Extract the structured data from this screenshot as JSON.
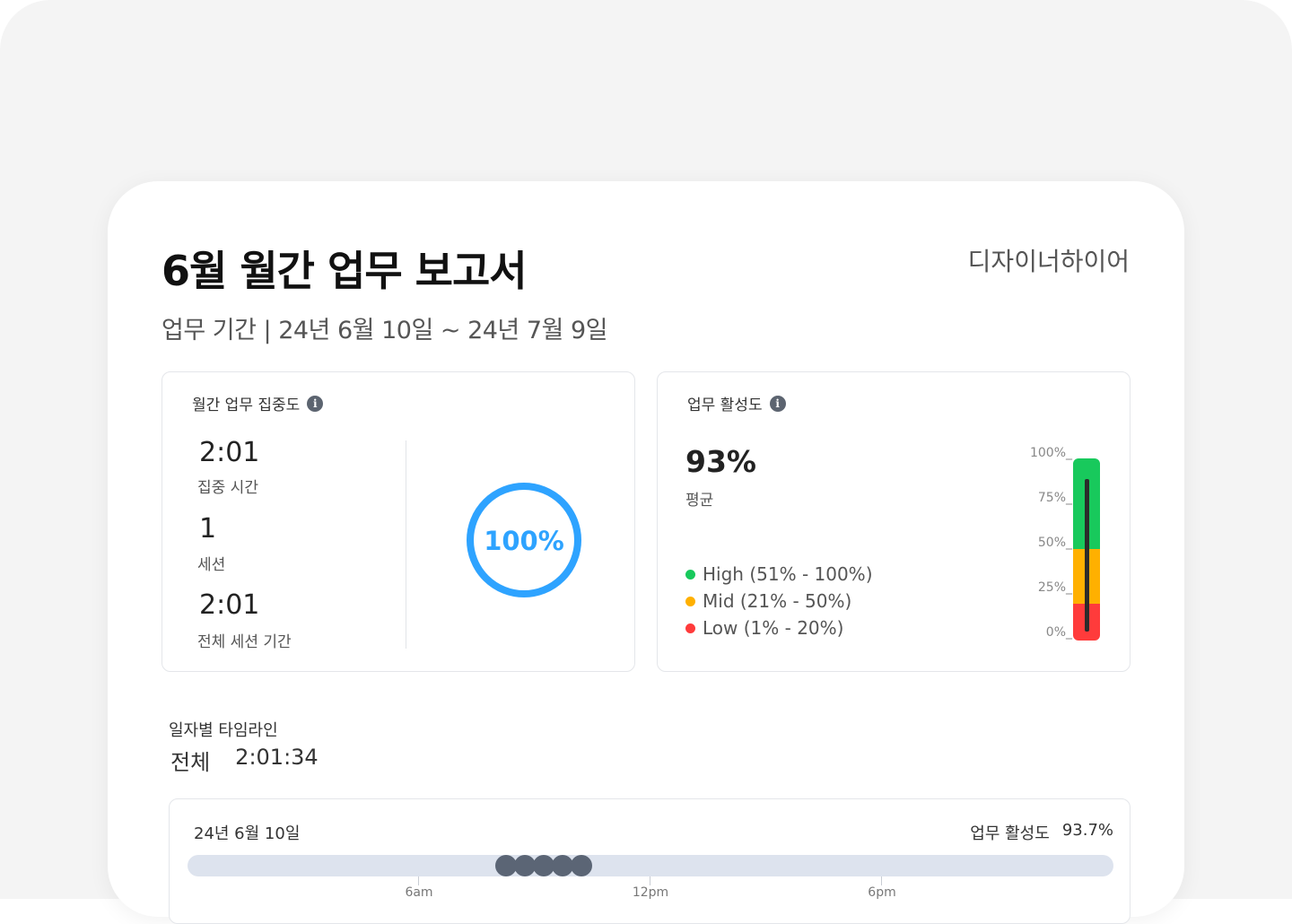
{
  "report": {
    "title": "6월 월간 업무 보고서",
    "brand": "디자이너하이어",
    "period": "업무 기간 | 24년 6월 10일 ~ 24년 7월 9일"
  },
  "focus_panel": {
    "heading": "월간 업무 집중도",
    "stats": [
      {
        "value": "2:01",
        "label": "집중 시간"
      },
      {
        "value": "1",
        "label": "세션"
      },
      {
        "value": "2:01",
        "label": "전체 세션 기간"
      }
    ],
    "ring_percent": 100,
    "ring_label": "100%",
    "ring_color": "#2ea3ff"
  },
  "activity_panel": {
    "heading": "업무 활성도",
    "average_value": "93%",
    "average_label": "평균",
    "legend": [
      {
        "label": "High (51% - 100%)",
        "color": "#18c95c"
      },
      {
        "label": "Mid (21% - 50%)",
        "color": "#ffb000"
      },
      {
        "label": "Low (1% - 20%)",
        "color": "#ff3b3b"
      }
    ],
    "gauge_ticks": [
      "100%_",
      "75%_",
      "50%_",
      "25%_",
      "0%_"
    ],
    "gauge_level_percent": 93
  },
  "timeline": {
    "title": "일자별 타임라인",
    "total_label": "전체",
    "total_value": "2:01:34",
    "days": [
      {
        "date": "24년 6월 10일",
        "activity_label": "업무 활성도",
        "activity_value": "93.7%",
        "sessions_count": 5,
        "time_labels": [
          "6am",
          "12pm",
          "6pm"
        ]
      }
    ]
  }
}
